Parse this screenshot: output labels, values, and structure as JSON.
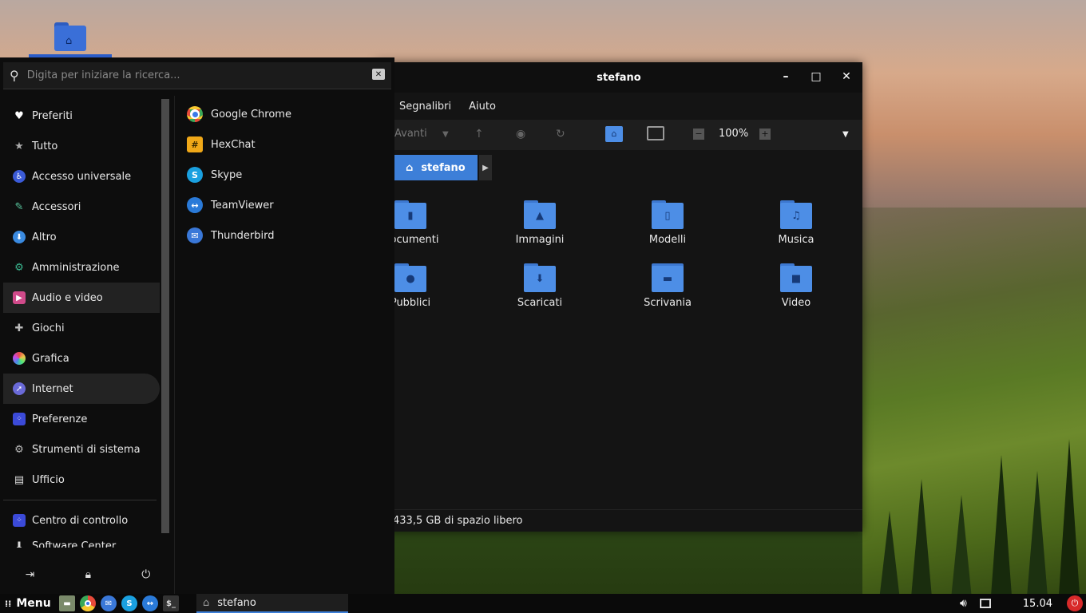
{
  "desktop": {
    "home_icon": "home-folder-icon"
  },
  "file_manager": {
    "title": "stefano",
    "menubar": [
      "Segnalibri",
      "Aiuto"
    ],
    "toolbar": {
      "forward_label": "Avanti",
      "zoom": "100%"
    },
    "breadcrumb": "stefano",
    "folders": [
      {
        "name": "Documenti",
        "glyph": "document-icon"
      },
      {
        "name": "Immagini",
        "glyph": "image-icon"
      },
      {
        "name": "Modelli",
        "glyph": "template-icon"
      },
      {
        "name": "Musica",
        "glyph": "music-icon"
      },
      {
        "name": "Pubblici",
        "glyph": "user-icon"
      },
      {
        "name": "Scaricati",
        "glyph": "download-icon"
      },
      {
        "name": "Scrivania",
        "glyph": "desktop-icon"
      },
      {
        "name": "Video",
        "glyph": "video-icon"
      }
    ],
    "status": "433,5 GB di spazio libero"
  },
  "menu": {
    "search_placeholder": "Digita per iniziare la ricerca...",
    "categories": [
      "Preferiti",
      "Tutto",
      "Accesso universale",
      "Accessori",
      "Altro",
      "Amministrazione",
      "Audio e video",
      "Giochi",
      "Grafica",
      "Internet",
      "Preferenze",
      "Strumenti di sistema",
      "Ufficio"
    ],
    "extra": [
      "Centro di controllo",
      "Software Center"
    ],
    "apps": [
      "Google Chrome",
      "HexChat",
      "Skype",
      "TeamViewer",
      "Thunderbird"
    ]
  },
  "taskbar": {
    "menu_label": "Menu",
    "window_label": "stefano",
    "clock": "15.04"
  }
}
